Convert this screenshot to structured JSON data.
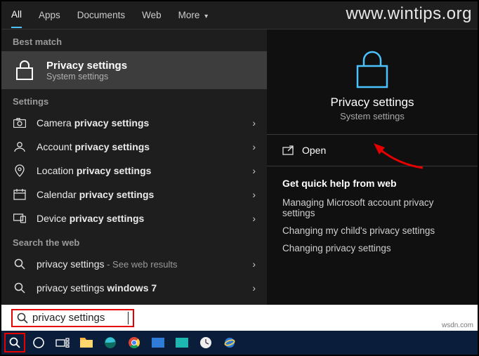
{
  "watermark": "www.wintips.org",
  "tabs": {
    "all": "All",
    "apps": "Apps",
    "documents": "Documents",
    "web": "Web",
    "more": "More"
  },
  "sections": {
    "best_match": "Best match",
    "settings": "Settings",
    "search_web": "Search the web"
  },
  "best_match": {
    "title": "Privacy settings",
    "subtitle": "System settings"
  },
  "settings_items": [
    {
      "pre": "Camera ",
      "bold": "privacy settings"
    },
    {
      "pre": "Account ",
      "bold": "privacy settings"
    },
    {
      "pre": "Location ",
      "bold": "privacy settings"
    },
    {
      "pre": "Calendar ",
      "bold": "privacy settings"
    },
    {
      "pre": "Device ",
      "bold": "privacy settings"
    }
  ],
  "web_items": [
    {
      "main": "privacy settings",
      "suffix": " - See web results"
    },
    {
      "main": "privacy settings ",
      "bold": "windows 7"
    }
  ],
  "detail": {
    "title": "Privacy settings",
    "subtitle": "System settings",
    "action_open": "Open",
    "quick_help_title": "Get quick help from web",
    "links": [
      "Managing Microsoft account privacy settings",
      "Changing my child's privacy settings",
      "Changing privacy settings"
    ]
  },
  "search": {
    "value": "privacy settings"
  },
  "footer_text": "wsdn.com"
}
